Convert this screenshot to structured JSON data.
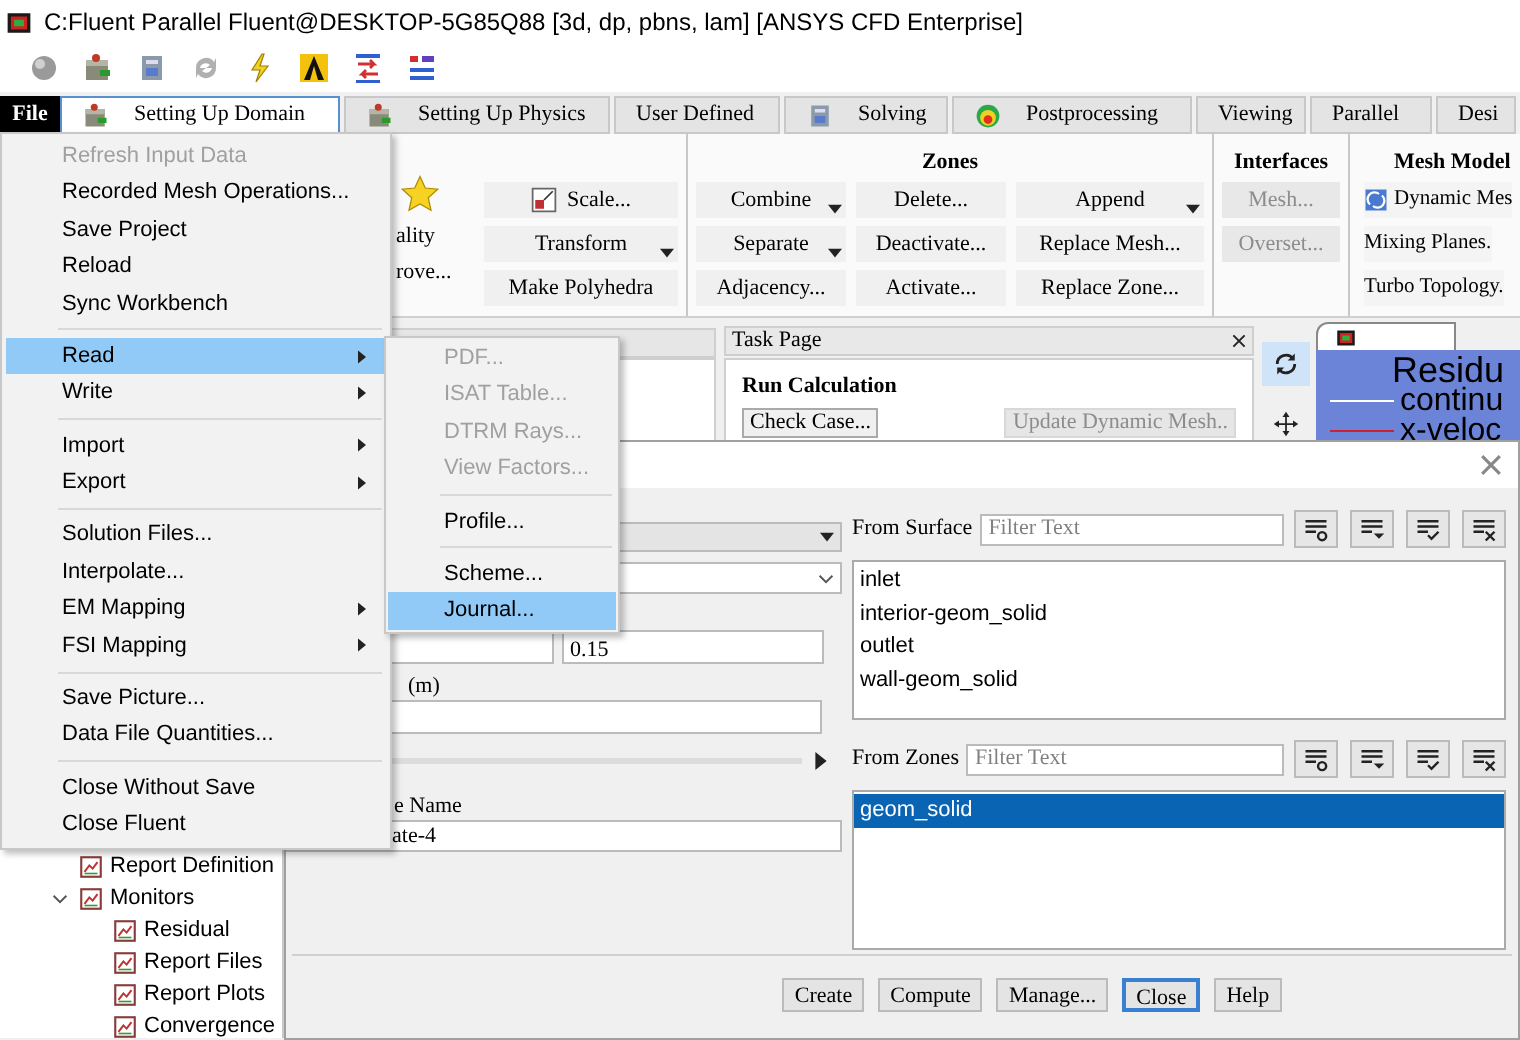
{
  "window": {
    "title": "C:Fluent Parallel Fluent@DESKTOP-5G85Q88  [3d, dp, pbns, lam] [ANSYS CFD Enterprise]"
  },
  "menu_button": {
    "label": "File",
    "open": true
  },
  "tabs": [
    {
      "label": "Setting Up Domain",
      "selected": true
    },
    {
      "label": "Setting Up Physics",
      "selected": false
    },
    {
      "label": "User Defined",
      "selected": false
    },
    {
      "label": "Solving",
      "selected": false
    },
    {
      "label": "Postprocessing",
      "selected": false
    },
    {
      "label": "Viewing",
      "selected": false
    },
    {
      "label": "Parallel",
      "selected": false
    },
    {
      "label": "Desi",
      "selected": false
    }
  ],
  "ribbon": {
    "partial_buttons": [
      "ality",
      "rove..."
    ],
    "mesh_buttons": [
      {
        "label": "Scale...",
        "dropdown": false
      },
      {
        "label": "Transform",
        "dropdown": true
      },
      {
        "label": "Make Polyhedra",
        "dropdown": false
      }
    ],
    "zones": {
      "title": "Zones",
      "buttons": [
        {
          "label": "Combine",
          "dropdown": true
        },
        {
          "label": "Delete...",
          "dropdown": false
        },
        {
          "label": "Append",
          "dropdown": true
        },
        {
          "label": "Separate",
          "dropdown": true
        },
        {
          "label": "Deactivate...",
          "dropdown": false
        },
        {
          "label": "Replace Mesh...",
          "dropdown": false
        },
        {
          "label": "Adjacency...",
          "dropdown": false
        },
        {
          "label": "Activate...",
          "dropdown": false
        },
        {
          "label": "Replace Zone...",
          "dropdown": false
        }
      ]
    },
    "interfaces": {
      "title": "Interfaces",
      "buttons": [
        {
          "label": "Mesh...",
          "disabled": true
        },
        {
          "label": "Overset...",
          "disabled": true
        }
      ]
    },
    "mesh_models": {
      "title": "Mesh Model",
      "buttons": [
        "Dynamic Mes",
        "Mixing Planes.",
        "Turbo Topology."
      ]
    }
  },
  "tree": [
    {
      "label": "Report Definition"
    },
    {
      "label": "Monitors",
      "expanded": true,
      "children": [
        {
          "label": "Residual"
        },
        {
          "label": "Report Files"
        },
        {
          "label": "Report Plots"
        },
        {
          "label": "Convergence"
        }
      ]
    }
  ],
  "task_page": {
    "title": "Task Page",
    "section": "Run Calculation",
    "buttons": [
      {
        "label": "Check Case...",
        "disabled": false
      },
      {
        "label": "Update Dynamic Mesh..",
        "disabled": true
      }
    ]
  },
  "graphics": {
    "legend_title": "Residu",
    "legend": [
      {
        "label": "continu",
        "color": "#ffffff"
      },
      {
        "label": "x-veloc",
        "color": "#d02030"
      }
    ]
  },
  "dialog": {
    "value": "0.15",
    "unit_label": "(m)",
    "name_label": "e Name",
    "name_value": "ate-4",
    "surfaces": {
      "label": "From Surface",
      "placeholder": "Filter Text",
      "items": [
        {
          "label": "inlet",
          "selected": false
        },
        {
          "label": "interior-geom_solid",
          "selected": false
        },
        {
          "label": "outlet",
          "selected": false
        },
        {
          "label": "wall-geom_solid",
          "selected": false
        }
      ]
    },
    "zones": {
      "label": "From Zones",
      "placeholder": "Filter Text",
      "items": [
        {
          "label": "geom_solid",
          "selected": true
        }
      ]
    },
    "buttons": [
      {
        "label": "Create",
        "focused": false
      },
      {
        "label": "Compute",
        "focused": false
      },
      {
        "label": "Manage...",
        "focused": false
      },
      {
        "label": "Close",
        "focused": true
      },
      {
        "label": "Help",
        "focused": false
      }
    ]
  },
  "file_menu": {
    "items": [
      {
        "kind": "item",
        "label": "Refresh Input Data",
        "disabled": true,
        "selected": false,
        "submenu": false
      },
      {
        "kind": "item",
        "label": "Recorded Mesh Operations...",
        "disabled": false,
        "selected": false,
        "submenu": false
      },
      {
        "kind": "item",
        "label": "Save Project",
        "disabled": false,
        "selected": false,
        "submenu": false
      },
      {
        "kind": "item",
        "label": "Reload",
        "disabled": false,
        "selected": false,
        "submenu": false
      },
      {
        "kind": "item",
        "label": "Sync Workbench",
        "disabled": false,
        "selected": false,
        "submenu": false
      },
      {
        "kind": "separator"
      },
      {
        "kind": "item",
        "label": "Read",
        "disabled": false,
        "selected": true,
        "submenu": true
      },
      {
        "kind": "item",
        "label": "Write",
        "disabled": false,
        "selected": false,
        "submenu": true
      },
      {
        "kind": "separator"
      },
      {
        "kind": "item",
        "label": "Import",
        "disabled": false,
        "selected": false,
        "submenu": true
      },
      {
        "kind": "item",
        "label": "Export",
        "disabled": false,
        "selected": false,
        "submenu": true
      },
      {
        "kind": "separator"
      },
      {
        "kind": "item",
        "label": "Solution Files...",
        "disabled": false,
        "selected": false,
        "submenu": false
      },
      {
        "kind": "item",
        "label": "Interpolate...",
        "disabled": false,
        "selected": false,
        "submenu": false
      },
      {
        "kind": "item",
        "label": "EM Mapping",
        "disabled": false,
        "selected": false,
        "submenu": true
      },
      {
        "kind": "item",
        "label": "FSI Mapping",
        "disabled": false,
        "selected": false,
        "submenu": true
      },
      {
        "kind": "separator"
      },
      {
        "kind": "item",
        "label": "Save Picture...",
        "disabled": false,
        "selected": false,
        "submenu": false
      },
      {
        "kind": "item",
        "label": "Data File Quantities...",
        "disabled": false,
        "selected": false,
        "submenu": false
      },
      {
        "kind": "separator"
      },
      {
        "kind": "item",
        "label": "Close Without Save",
        "disabled": false,
        "selected": false,
        "submenu": false
      },
      {
        "kind": "item",
        "label": "Close Fluent",
        "disabled": false,
        "selected": false,
        "submenu": false
      }
    ]
  },
  "read_submenu": {
    "items": [
      {
        "kind": "item",
        "label": "PDF...",
        "disabled": true,
        "selected": false
      },
      {
        "kind": "item",
        "label": "ISAT Table...",
        "disabled": true,
        "selected": false
      },
      {
        "kind": "item",
        "label": "DTRM Rays...",
        "disabled": true,
        "selected": false
      },
      {
        "kind": "item",
        "label": "View Factors...",
        "disabled": true,
        "selected": false
      },
      {
        "kind": "separator"
      },
      {
        "kind": "item",
        "label": "Profile...",
        "disabled": false,
        "selected": false
      },
      {
        "kind": "separator"
      },
      {
        "kind": "item",
        "label": "Scheme...",
        "disabled": false,
        "selected": false
      },
      {
        "kind": "item",
        "label": "Journal...",
        "disabled": false,
        "selected": true
      }
    ]
  }
}
